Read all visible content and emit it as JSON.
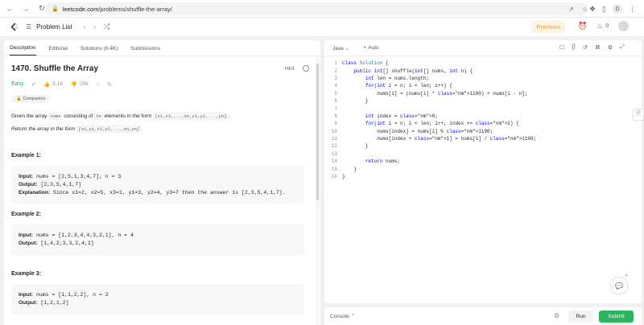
{
  "browser": {
    "url_host": "leetcode.com",
    "url_path": "/problems/shuffle-the-array/",
    "profile_initial": "D"
  },
  "header": {
    "problem_list_label": "Problem List",
    "premium_label": "Premium",
    "notification_count": "0"
  },
  "tabs": [
    "Description",
    "Editorial",
    "Solutions (6.4K)",
    "Submissions"
  ],
  "problem": {
    "title": "1470. Shuffle the Array",
    "hint_label": "Hint",
    "difficulty": "Easy",
    "likes": "5.1K",
    "dislikes": "259",
    "companies_label": "Companies",
    "desc_part1": "Given the array ",
    "desc_code_nums": "nums",
    "desc_part2": " consisting of ",
    "desc_code_2n": "2n",
    "desc_part3": " elements in the form ",
    "desc_form_in": "[x1,x2,...,xn,y1,y2,...,yn]",
    "desc_part4": ".",
    "return_text": "Return the array in the form ",
    "return_form": "[x1,y1,x2,y2,...,xn,yn]",
    "return_end": "."
  },
  "examples": [
    {
      "title": "Example 1:",
      "input_label": "Input:",
      "input": "nums = [2,5,1,3,4,7], n = 3",
      "output_label": "Output:",
      "output": "[2,3,5,4,1,7]",
      "explanation_label": "Explanation:",
      "explanation": "Since x1=2, x2=5, x3=1, y1=3, y2=4, y3=7 then the answer is [2,3,5,4,1,7]."
    },
    {
      "title": "Example 2:",
      "input_label": "Input:",
      "input": "nums = [1,2,3,4,4,3,2,1], n = 4",
      "output_label": "Output:",
      "output": "[1,4,2,3,3,2,4,1]"
    },
    {
      "title": "Example 3:",
      "input_label": "Input:",
      "input": "nums = [1,1,2,2], n = 2",
      "output_label": "Output:",
      "output": "[1,2,1,2]"
    }
  ],
  "editor": {
    "language": "Java",
    "mode": "Auto",
    "code_lines": [
      "class Solution {",
      "    public int[] shuffle(int[] nums, int n) {",
      "        int len = nums.length;",
      "        for(int i = n; i < len; i++) {",
      "            nums[i] = (nums[i] * 1100) + nums[i - n];",
      "        }",
      "",
      "        int index = 0;",
      "        for(int i = n; i < len; i++, index += 2) {",
      "            nums[index] = nums[i] % 1100;",
      "            nums[index + 1] = nums[i] / 1100;",
      "        }",
      "",
      "        return nums;",
      "    }",
      "}"
    ]
  },
  "console": {
    "console_label": "Console",
    "run_label": "Run",
    "submit_label": "Submit"
  },
  "colors": {
    "accent_green": "#2db55d",
    "easy_color": "#00af9b",
    "premium_color": "#e3a02f"
  }
}
